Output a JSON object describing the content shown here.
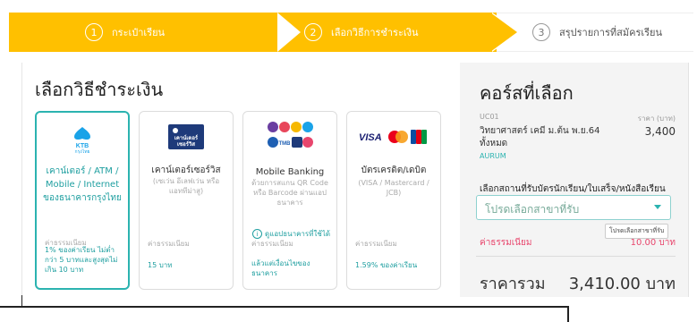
{
  "steps": [
    {
      "num": "1",
      "label": "กระเป๋าเรียน"
    },
    {
      "num": "2",
      "label": "เลือกวิธีการชำระเงิน"
    },
    {
      "num": "3",
      "label": "สรุปรายการที่สมัครเรียน"
    }
  ],
  "payment": {
    "title": "เลือกวิธีชำระเงิน",
    "cards": [
      {
        "logo_text": "KTB กรุงไทย",
        "name": "เคาน์เตอร์ / ATM / Mobile / Internet ของธนาคารกรุงไทย",
        "sub": "",
        "fee_label": "ค่าธรรมเนียม",
        "fee": "1% ของค่าเรียน ไม่ต่ำกว่า 5 บาทและสูงสุดไม่เกิน 10 บาท"
      },
      {
        "logo_text": "เคาน์เตอร์ เซอร์วิส",
        "name": "เคาน์เตอร์เซอร์วิส",
        "sub": "(เซเว่น อีเลฟเว่น หรือ แอททีม่าสู)",
        "fee_label": "ค่าธรรมเนียม",
        "fee": "15 บาท"
      },
      {
        "logo_text": "",
        "name": "Mobile Banking",
        "sub": "ด้วยการสแกน QR Code หรือ Barcode ผ่านแอปธนาคาร",
        "link": "ดูแอปธนาคารที่ใช้ได้",
        "fee_label": "ค่าธรรมเนียม",
        "fee": "แล้วแต่เงื่อนไขของธนาคาร"
      },
      {
        "logo_text": "VISA JCB",
        "name": "บัตรเครดิต/เดบิต",
        "sub": "(VISA / Mastercard / JCB)",
        "fee_label": "ค่าธรรมเนียม",
        "fee": "1.59% ของค่าเรียน"
      }
    ]
  },
  "summary": {
    "title": "คอร์สที่เลือก",
    "course_code": "UC01",
    "price_header": "ราคา (บาท)",
    "course_name": "วิทยาศาสตร์ เคมี ม.ต้น พ.ย.64 ทั้งหมด",
    "course_price": "3,400",
    "course_tag": "AURUM",
    "pickup_label": "เลือกสถานที่รับบัตรนักเรียน/ใบเสร็จ/หนังสือเรียน",
    "select_placeholder": "โปรดเลือกสาขาที่รับ",
    "tooltip": "โปรดเลือกสาขาที่รับ",
    "fee_label": "ค่าธรรมเนียม",
    "fee_value": "10.00 บาท",
    "total_label": "ราคารวม",
    "total_value": "3,410.00 บาท"
  },
  "colors": {
    "accent": "#2bb3b0",
    "step_active": "#ffc000",
    "fee_pink": "#e8466d",
    "ktb_blue": "#1aa3e8",
    "counter_navy": "#1e3a7a"
  }
}
